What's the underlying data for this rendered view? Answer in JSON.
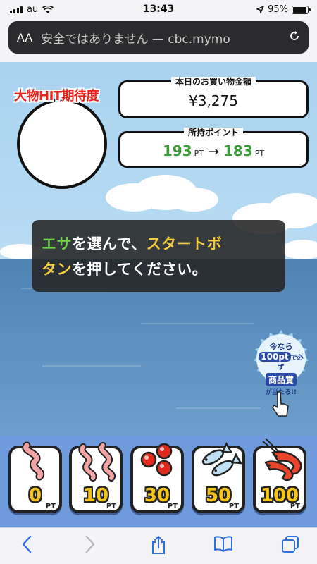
{
  "status": {
    "carrier": "au",
    "time": "13:43",
    "battery": "95%",
    "battery_level": 0.95
  },
  "url": {
    "aa": "AA",
    "text": "安全ではありません — cbc.mymo",
    "reload_icon": "reload-icon"
  },
  "game": {
    "hit_title": "大物HIT期待度",
    "purchase": {
      "title": "本日のお買い物金額",
      "amount": "¥3,275"
    },
    "points": {
      "title": "所持ポイント",
      "from": "193",
      "arrow": "→",
      "to": "183",
      "unit": "PT"
    },
    "message": {
      "part1": "エサ",
      "part2": "を選んで、",
      "part3": "スタートボ",
      "part4": "タン",
      "part5": "を押してください。"
    },
    "badge": {
      "line1": "今なら",
      "line2_hl": "100pt",
      "line2_rest": "で必ず",
      "line3": "商品賞",
      "line4": "が当たる!!"
    },
    "baits": [
      {
        "icon": "worm-icon",
        "price": "0",
        "unit": "PT"
      },
      {
        "icon": "worms-icon",
        "price": "10",
        "unit": "PT"
      },
      {
        "icon": "red-balls-icon",
        "price": "30",
        "unit": "PT"
      },
      {
        "icon": "fish-icon",
        "price": "50",
        "unit": "PT"
      },
      {
        "icon": "shrimp-icon",
        "price": "100",
        "unit": "PT"
      }
    ],
    "colors": {
      "hit_title": "#e8231c",
      "points_green": "#3a9a36",
      "message_green": "#6fcf4a",
      "message_yellow": "#f5cc3b",
      "price_yellow": "#f6c51b",
      "tray": "#6f9bdc"
    }
  },
  "toolbar": {
    "back": "back-icon",
    "forward": "forward-icon",
    "share": "share-icon",
    "bookmarks": "book-icon",
    "tabs": "tabs-icon"
  }
}
